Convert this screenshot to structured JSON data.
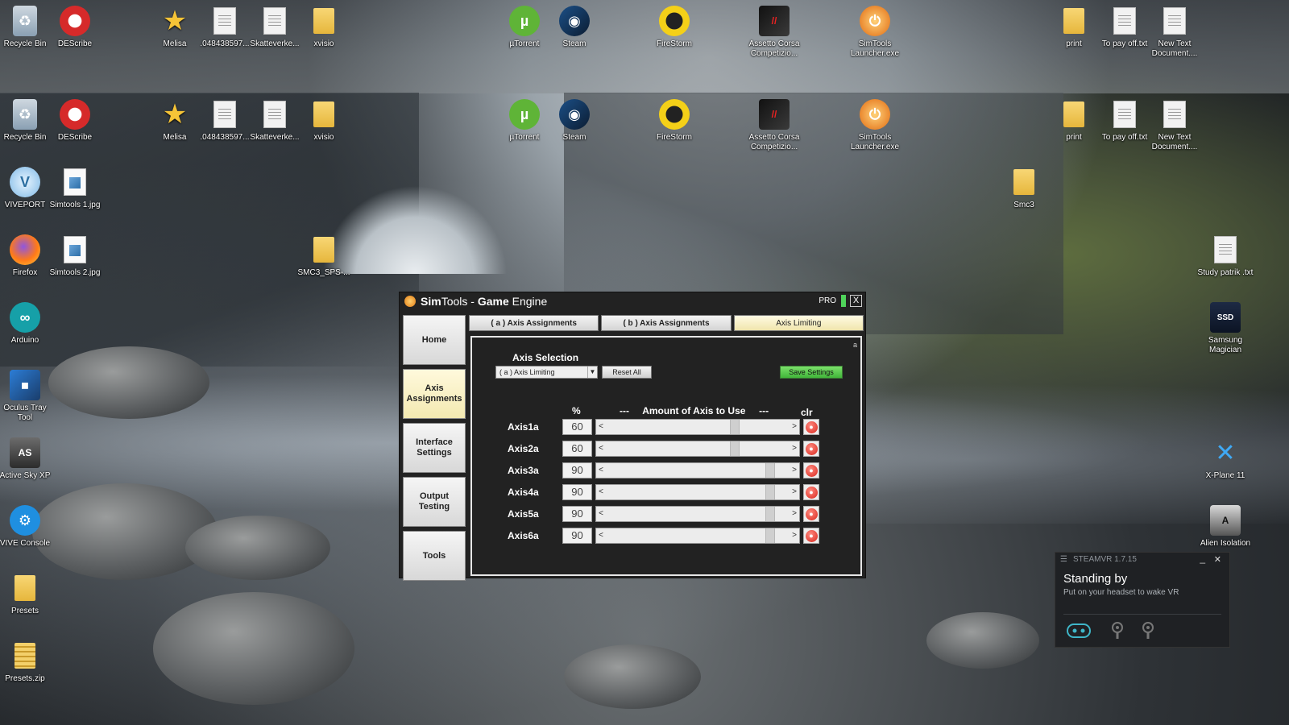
{
  "desktop": {
    "icons": [
      {
        "label": "Recycle Bin",
        "icon": "recycle-bin-icon"
      },
      {
        "label": "DEScribe",
        "icon": "describe-icon"
      },
      {
        "label": "Melisa",
        "icon": "star-icon"
      },
      {
        "label": ".048438597...",
        "icon": "document-icon"
      },
      {
        "label": "Skatteverke...",
        "icon": "document-icon"
      },
      {
        "label": "xvisio",
        "icon": "folder-icon"
      },
      {
        "label": "µTorrent",
        "icon": "utorrent-icon"
      },
      {
        "label": "Steam",
        "icon": "steam-icon"
      },
      {
        "label": "FireStorm",
        "icon": "firestorm-icon"
      },
      {
        "label": "Assetto Corsa Competizio...",
        "icon": "assetto-corsa-icon"
      },
      {
        "label": "SimTools Launcher.exe",
        "icon": "simtools-launcher-icon"
      },
      {
        "label": "print",
        "icon": "folder-icon"
      },
      {
        "label": "To pay off.txt",
        "icon": "document-icon"
      },
      {
        "label": "New Text Document....",
        "icon": "document-icon"
      },
      {
        "label": "Recycle Bin",
        "icon": "recycle-bin-icon"
      },
      {
        "label": "DEScribe",
        "icon": "describe-icon"
      },
      {
        "label": "Melisa",
        "icon": "star-icon"
      },
      {
        "label": ".048438597...",
        "icon": "document-icon"
      },
      {
        "label": "Skatteverke...",
        "icon": "document-icon"
      },
      {
        "label": "xvisio",
        "icon": "folder-icon"
      },
      {
        "label": "µTorrent",
        "icon": "utorrent-icon"
      },
      {
        "label": "Steam",
        "icon": "steam-icon"
      },
      {
        "label": "FireStorm",
        "icon": "firestorm-icon"
      },
      {
        "label": "Assetto Corsa Competizio...",
        "icon": "assetto-corsa-icon"
      },
      {
        "label": "SimTools Launcher.exe",
        "icon": "simtools-launcher-icon"
      },
      {
        "label": "print",
        "icon": "folder-icon"
      },
      {
        "label": "To pay off.txt",
        "icon": "document-icon"
      },
      {
        "label": "New Text Document....",
        "icon": "document-icon"
      },
      {
        "label": "VIVEPORT",
        "icon": "viveport-icon"
      },
      {
        "label": "Simtools 1.jpg",
        "icon": "image-file-icon"
      },
      {
        "label": "Firefox",
        "icon": "firefox-icon"
      },
      {
        "label": "Simtools 2.jpg",
        "icon": "image-file-icon"
      },
      {
        "label": "SMC3_SPS-...",
        "icon": "folder-icon"
      },
      {
        "label": "Arduino",
        "icon": "arduino-icon"
      },
      {
        "label": "Oculus Tray Tool",
        "icon": "oculus-tray-icon"
      },
      {
        "label": "Active Sky XP",
        "icon": "active-sky-icon"
      },
      {
        "label": "VIVE Console",
        "icon": "vive-console-icon"
      },
      {
        "label": "Presets",
        "icon": "folder-icon"
      },
      {
        "label": "Presets.zip",
        "icon": "zip-folder-icon"
      },
      {
        "label": "Smc3",
        "icon": "folder-icon"
      },
      {
        "label": "Study patrik .txt",
        "icon": "document-icon"
      },
      {
        "label": "Samsung Magician",
        "icon": "samsung-magician-icon"
      },
      {
        "label": "X-Plane 11",
        "icon": "xplane-icon"
      },
      {
        "label": "Alien Isolation",
        "icon": "alien-isolation-icon"
      }
    ]
  },
  "simtools": {
    "title_sim": "Sim",
    "title_tools": "Tools",
    "title_dash": " - ",
    "title_game": "Game",
    "title_engine": " Engine",
    "pro_label": "PRO",
    "close_label": "X",
    "sidebar": [
      {
        "label": "Home"
      },
      {
        "label": "Axis Assignments"
      },
      {
        "label": "Interface Settings"
      },
      {
        "label": "Output Testing"
      },
      {
        "label": "Tools"
      }
    ],
    "tabs": [
      {
        "label": "( a ) Axis Assignments"
      },
      {
        "label": "( b ) Axis Assignments"
      },
      {
        "label": "Axis Limiting"
      }
    ],
    "panel": {
      "corner_label": "a",
      "axis_selection_label": "Axis Selection",
      "axis_dropdown_value": "( a ) Axis Limiting",
      "reset_all_label": "Reset All",
      "save_settings_label": "Save Settings",
      "col_percent": "%",
      "col_amount": "---     Amount of Axis to Use     ---",
      "col_clr": "clr",
      "slider_left": "<",
      "slider_right": ">",
      "axes": [
        {
          "name": "Axis1a",
          "value": "60",
          "level": 0.6
        },
        {
          "name": "Axis2a",
          "value": "60",
          "level": 0.6
        },
        {
          "name": "Axis3a",
          "value": "90",
          "level": 0.9
        },
        {
          "name": "Axis4a",
          "value": "90",
          "level": 0.9
        },
        {
          "name": "Axis5a",
          "value": "90",
          "level": 0.9
        },
        {
          "name": "Axis6a",
          "value": "90",
          "level": 0.9
        }
      ]
    },
    "colors": {
      "save_button": "#42b53a",
      "active_tab": "#f0e5ac",
      "status_indicator": "#4fd35a"
    }
  },
  "steamvr": {
    "title": "STEAMVR 1.7.15",
    "status": "Standing by",
    "subtitle": "Put on your headset to wake VR",
    "devices": [
      "headset-icon",
      "controller-icon",
      "controller-icon"
    ]
  }
}
